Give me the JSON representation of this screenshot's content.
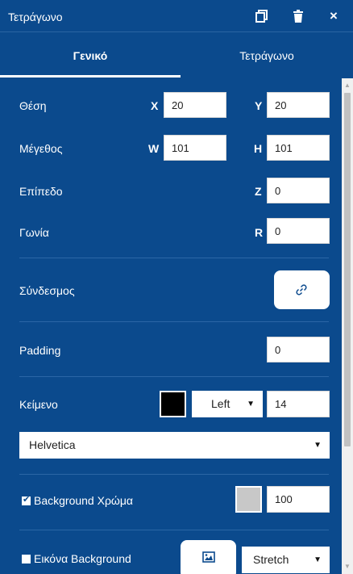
{
  "panel": {
    "title": "Τετράγωνο",
    "icons": [
      "copy-icon",
      "trash-icon",
      "close-icon"
    ],
    "close_glyph": "×"
  },
  "tabs": [
    {
      "label": "Γενικό",
      "active": true
    },
    {
      "label": "Τετράγωνο",
      "active": false
    }
  ],
  "position": {
    "label": "Θέση",
    "x_label": "X",
    "x_value": "20",
    "y_label": "Y",
    "y_value": "20"
  },
  "size": {
    "label": "Μέγεθος",
    "w_label": "W",
    "w_value": "101",
    "h_label": "H",
    "h_value": "101"
  },
  "layer": {
    "label": "Επίπεδο",
    "z_label": "Z",
    "z_value": "0"
  },
  "angle": {
    "label": "Γωνία",
    "r_label": "R",
    "r_value": "0"
  },
  "link": {
    "label": "Σύνδεσμος",
    "icon": "link-icon"
  },
  "padding": {
    "label": "Padding",
    "value": "0"
  },
  "text": {
    "label": "Κείμενο",
    "color": "#000000",
    "align_value": "Left",
    "size_value": "14",
    "font_value": "Helvetica"
  },
  "background_color": {
    "label": "Background Χρώμα",
    "checked": true,
    "color": "#c8c8c8",
    "opacity_value": "100"
  },
  "background_image": {
    "label": "Εικόνα Background",
    "checked": false,
    "icon": "image-icon",
    "mode_value": "Stretch"
  },
  "colors": {
    "panel_bg": "#0b4a8d",
    "divider": "#2b66a6"
  }
}
